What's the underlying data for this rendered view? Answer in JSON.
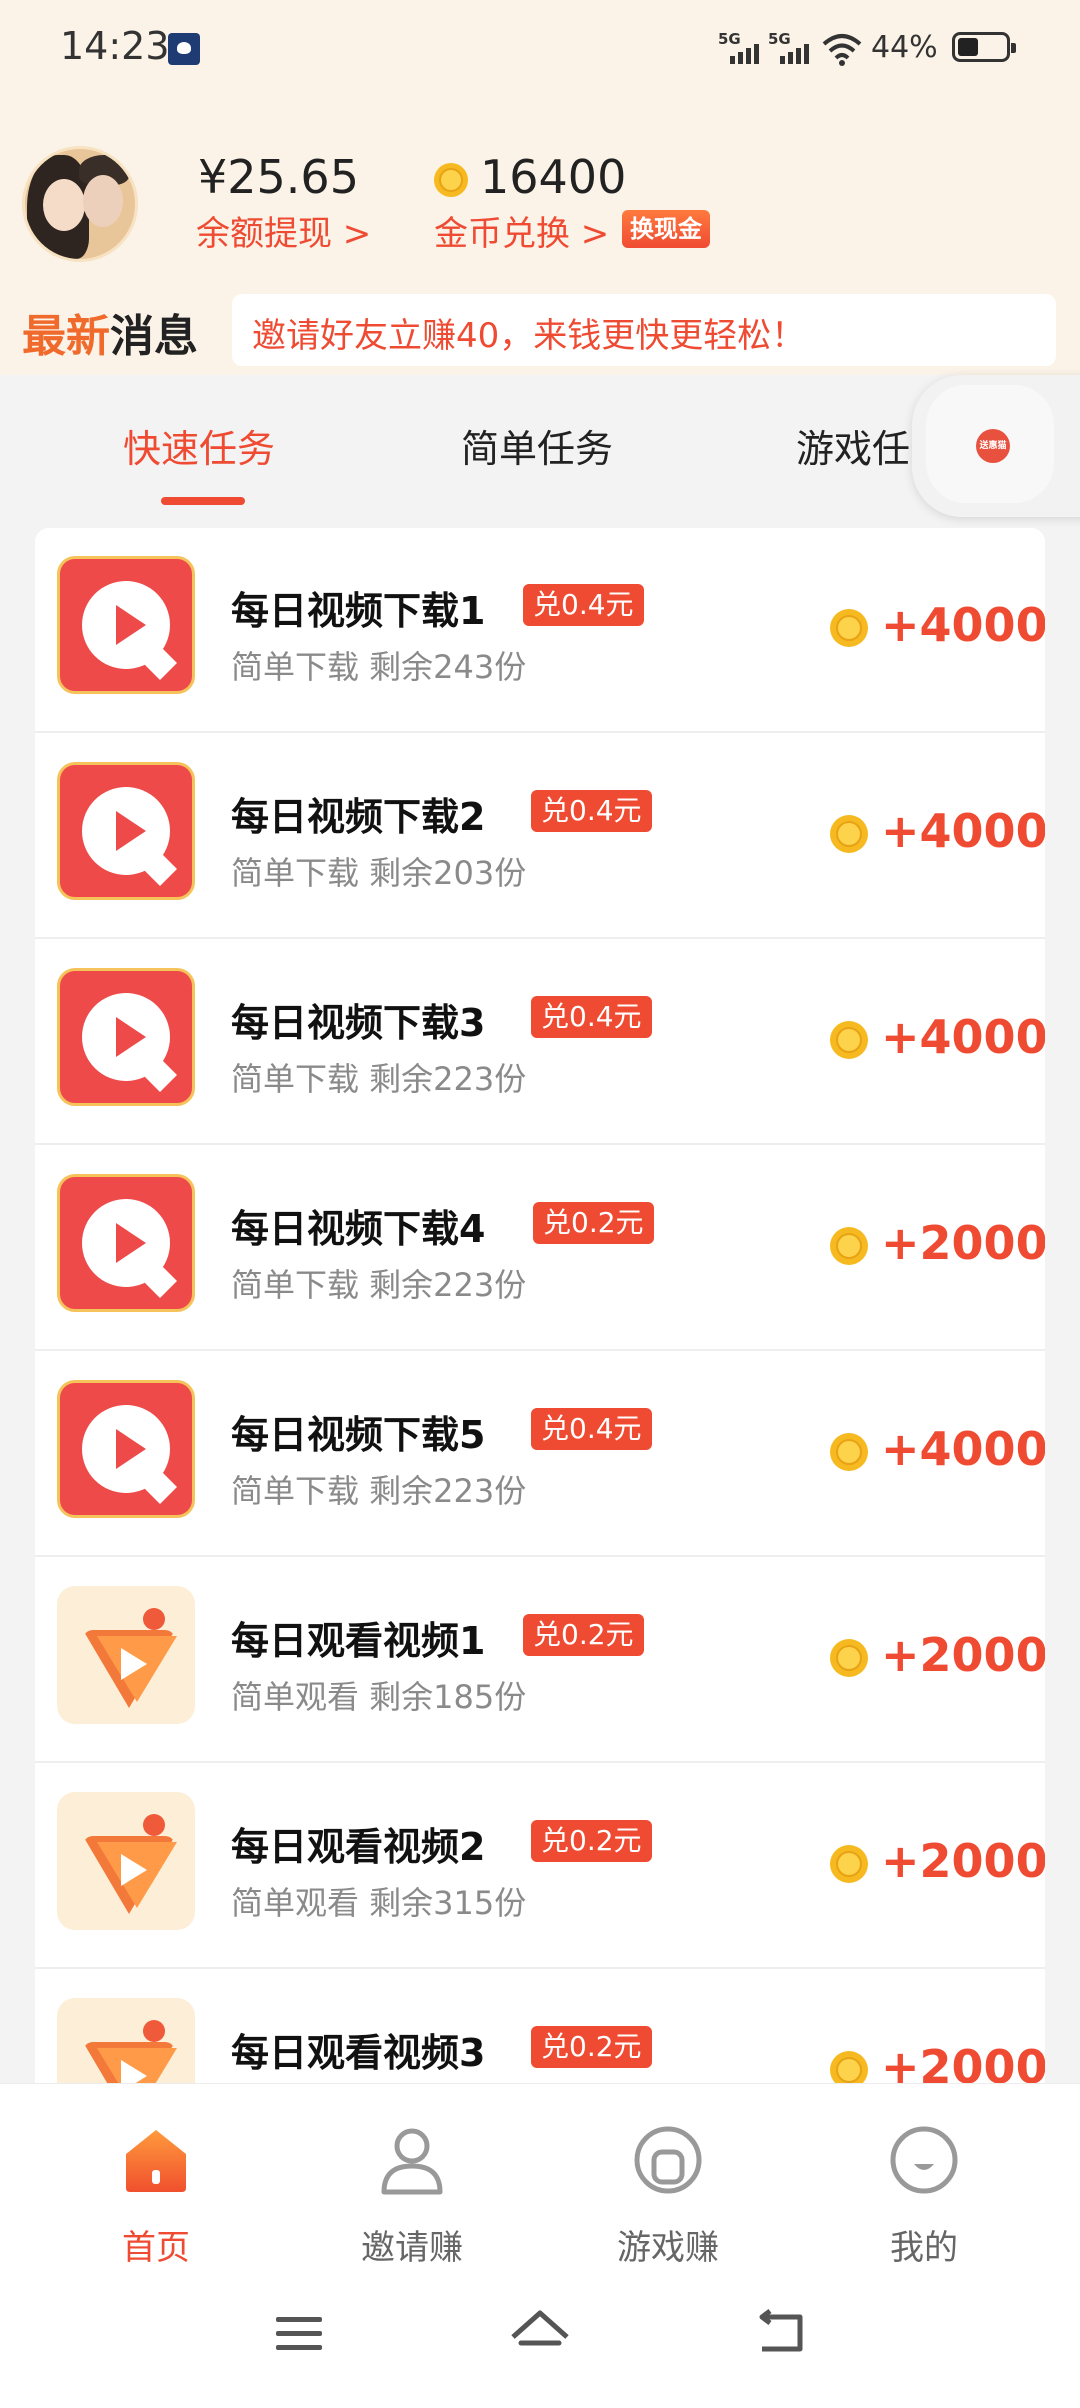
{
  "status_bar": {
    "time": "14:23",
    "signal1": "5G",
    "signal2": "5G",
    "battery": "44%"
  },
  "header": {
    "balance": "¥25.65",
    "balance_link": "余额提现 >",
    "coins": "16400",
    "coin_link": "金币兑换 >",
    "cash_badge": "换现金"
  },
  "news": {
    "title_a": "最新",
    "title_b": "消息",
    "text": "邀请好友立赚40，来钱更快更轻松！"
  },
  "tabs": [
    {
      "label": "快速任务"
    },
    {
      "label": "简单任务"
    },
    {
      "label": "游戏任务"
    }
  ],
  "float_button": {
    "icon": "red-packet-icon",
    "label": "送惠猫"
  },
  "tasks": [
    {
      "title": "每日视频下载1",
      "badge": "兑0.4元",
      "sub": "简单下载  剩余243份",
      "reward": "+4000",
      "icon": "red-play-icon"
    },
    {
      "title": "每日视频下载2",
      "badge": "兑0.4元",
      "sub": "简单下载  剩余203份",
      "reward": "+4000",
      "icon": "red-play-icon"
    },
    {
      "title": "每日视频下载3",
      "badge": "兑0.4元",
      "sub": "简单下载  剩余223份",
      "reward": "+4000",
      "icon": "red-play-icon"
    },
    {
      "title": "每日视频下载4",
      "badge": "兑0.2元",
      "sub": "简单下载  剩余223份",
      "reward": "+2000",
      "icon": "red-play-icon"
    },
    {
      "title": "每日视频下载5",
      "badge": "兑0.4元",
      "sub": "简单下载  剩余223份",
      "reward": "+4000",
      "icon": "red-play-icon"
    },
    {
      "title": "每日观看视频1",
      "badge": "兑0.2元",
      "sub": "简单观看  剩余185份",
      "reward": "+2000",
      "icon": "orange-play-icon"
    },
    {
      "title": "每日观看视频2",
      "badge": "兑0.2元",
      "sub": "简单观看  剩余315份",
      "reward": "+2000",
      "icon": "orange-play-icon"
    },
    {
      "title": "每日观看视频3",
      "badge": "兑0.2元",
      "sub": "",
      "reward": "+2000",
      "icon": "orange-play-icon"
    }
  ],
  "bottom_nav": [
    {
      "label": "首页",
      "icon": "home-icon",
      "active": true
    },
    {
      "label": "邀请赚",
      "icon": "person-icon",
      "active": false
    },
    {
      "label": "游戏赚",
      "icon": "gamepad-icon",
      "active": false
    },
    {
      "label": "我的",
      "icon": "smile-icon",
      "active": false
    }
  ],
  "colors": {
    "accent": "#ef4b33",
    "header_bg": "#fbf3e8",
    "coin": "#f6b91f"
  }
}
